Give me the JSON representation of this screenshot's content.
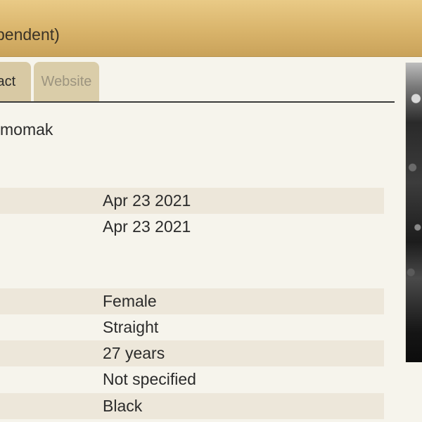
{
  "header": {
    "title": "pendent)"
  },
  "tabs": [
    {
      "label": "tact"
    },
    {
      "label": "Website"
    }
  ],
  "profile": {
    "username": "momak"
  },
  "details": [
    {
      "value": "Apr 23 2021"
    },
    {
      "value": "Apr 23 2021"
    },
    {
      "value": "Female"
    },
    {
      "value": "Straight"
    },
    {
      "value": "27 years"
    },
    {
      "value": "Not specified"
    },
    {
      "value": "Black"
    }
  ],
  "colors": {
    "header_gold": "#d9b46b",
    "page_bg": "#f6f4ec",
    "row_shade": "#ede7da",
    "tab_bg": "#d8c9a4",
    "tab_inactive_text": "#9c947f"
  }
}
